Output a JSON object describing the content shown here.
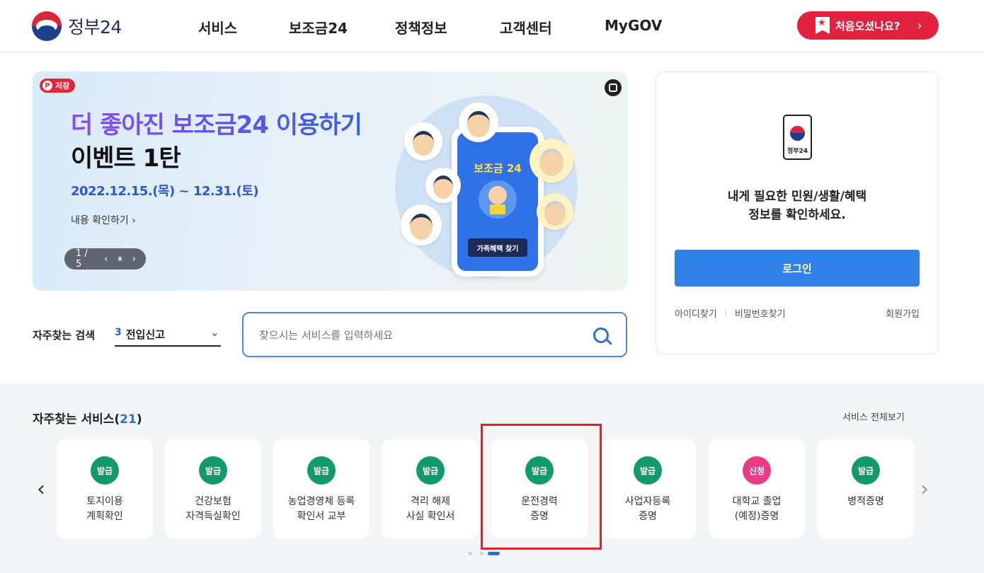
{
  "header": {
    "logo_text": "정부24",
    "nav": [
      "서비스",
      "보조금24",
      "정책정보",
      "고객센터",
      "MyGOV"
    ],
    "first_visit_label": "처음오셨나요?"
  },
  "banner": {
    "save_label": "저장",
    "title_line1": "더 좋아진 보조금24 이용하기",
    "title_line2": "이벤트 1탄",
    "date": "2022.12.15.(목) ~ 12.31.(토)",
    "link": "내용 확인하기 ›",
    "counter": "1 / 5",
    "phone_title": "보조금 24",
    "phone_button": "가족혜택 찾기"
  },
  "login": {
    "phone_caption": "정부24",
    "message_line1": "내게 필요한 민원/생활/혜택",
    "message_line2": "정보를 확인하세요.",
    "login_button": "로그인",
    "find_id": "아이디찾기",
    "find_pw": "비밀번호찾기",
    "signup": "회원가입"
  },
  "search": {
    "label": "자주찾는 검색",
    "selected_num": "3",
    "selected_text": "전입신고",
    "placeholder": "찾으시는 서비스를 입력하세요"
  },
  "services": {
    "title": "자주찾는 서비스(",
    "count": "21",
    "title_end": ")",
    "view_all": "서비스 전체보기",
    "cards": [
      {
        "badge": "발급",
        "name": "토지이용\n계획확인"
      },
      {
        "badge": "발급",
        "name": "건강보험\n자격득실확인"
      },
      {
        "badge": "발급",
        "name": "농업경영체 등록\n확인서 교부"
      },
      {
        "badge": "발급",
        "name": "격리 해제\n사실 확인서"
      },
      {
        "badge": "발급",
        "name": "운전경력\n증명"
      },
      {
        "badge": "발급",
        "name": "사업자등록\n증명"
      },
      {
        "badge": "신청",
        "name": "대학교 졸업\n(예정)증명"
      },
      {
        "badge": "발급",
        "name": "병적증명"
      }
    ]
  },
  "colors": {
    "accent_blue": "#2f80e7",
    "badge_green": "#139a6c",
    "badge_pink": "#ec3a86",
    "brand_red": "#e1223e",
    "highlight_red": "#e0242e"
  }
}
